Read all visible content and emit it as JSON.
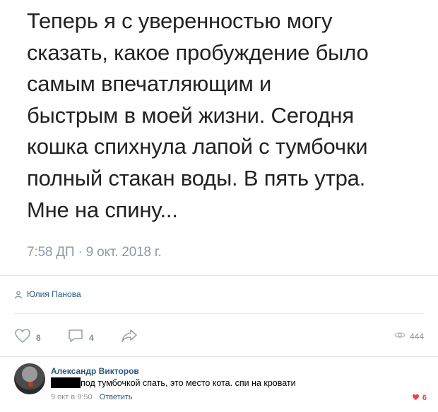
{
  "tweet": {
    "lines": [
      "Теперь я с уверенностью могу",
      "сказать, какое пробуждение было",
      "самым впечатляющим и",
      "быстрым в моей жизни. Сегодня",
      "кошка спихнула лапой с тумбочки",
      "полный стакан воды. В пять утра.",
      "Мне на спину..."
    ],
    "timestamp": "7:58 ДП · 9 окт. 2018 г."
  },
  "post": {
    "author": "Юлия Панова",
    "likes": "8",
    "comments": "4",
    "views": "444"
  },
  "comment": {
    "author": "Александр Викторов",
    "text": "под тумбочкой спать, это место кота. спи на кровати",
    "date": "9 окт в 9:50",
    "reply_label": "Ответить",
    "likes": "6"
  },
  "colors": {
    "link": "#2a5885",
    "muted": "#828a99",
    "like_red": "#e64646"
  },
  "icons": {
    "author": "user-icon",
    "like": "heart-outline-icon",
    "comment": "comment-bubble-icon",
    "share": "share-arrow-icon",
    "views": "eye-icon",
    "comment_like": "heart-filled-icon"
  }
}
